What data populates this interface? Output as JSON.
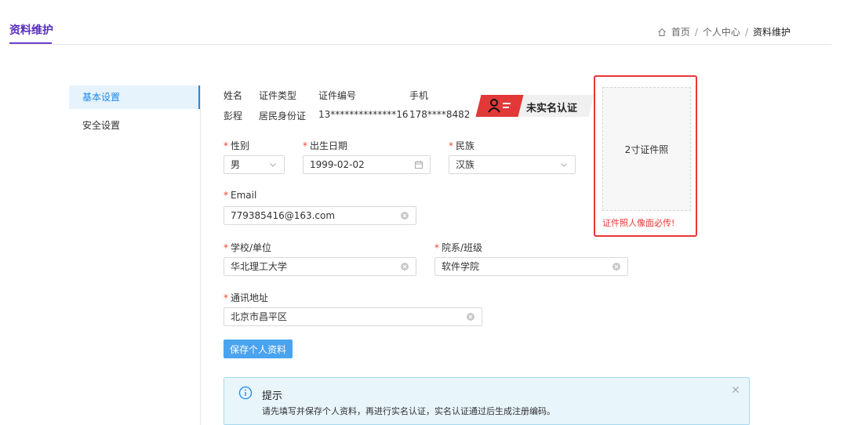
{
  "header": {
    "title": "资料维护",
    "breadcrumb": {
      "home": "首页",
      "sep1": "/",
      "middle": "个人中心",
      "sep2": "/",
      "current": "资料维护"
    }
  },
  "sidebar": {
    "items": [
      {
        "label": "基本设置",
        "active": true
      },
      {
        "label": "安全设置",
        "active": false
      }
    ]
  },
  "profile": {
    "headers": {
      "name": "姓名",
      "id_type": "证件类型",
      "id_number": "证件编号",
      "phone": "手机"
    },
    "values": {
      "name": "彭程",
      "id_type": "居民身份证",
      "id_number": "13**************16",
      "phone": "178****8482"
    },
    "verify_badge": "未实名认证"
  },
  "photo": {
    "placeholder": "2寸证件照",
    "warning": "证件照人像面必传!"
  },
  "form": {
    "required_mark": "*",
    "gender": {
      "label": "性别",
      "value": "男"
    },
    "birthdate": {
      "label": "出生日期",
      "value": "1999-02-02"
    },
    "ethnicity": {
      "label": "民族",
      "value": "汉族"
    },
    "email": {
      "label": "Email",
      "value": "779385416@163.com"
    },
    "school": {
      "label": "学校/单位",
      "value": "华北理工大学"
    },
    "department": {
      "label": "院系/班级",
      "value": "软件学院"
    },
    "address": {
      "label": "通讯地址",
      "value": "北京市昌平区"
    },
    "save_label": "保存个人资料"
  },
  "alert": {
    "title": "提示",
    "message": "请先填写并保存个人资料，再进行实名认证，实名认证通过后生成注册编码。"
  },
  "colors": {
    "accent": "#1e88e5",
    "title": "#5a2fbe",
    "danger": "#e53935",
    "button": "#4aa3ef",
    "alert_bg": "#e8f5fb"
  },
  "icons": {
    "home": "home-icon",
    "calendar": "calendar-icon",
    "clear": "clear-icon",
    "dropdown": "chevron-down-icon",
    "info": "info-icon",
    "close": "close-icon",
    "verify": "id-card-icon"
  }
}
